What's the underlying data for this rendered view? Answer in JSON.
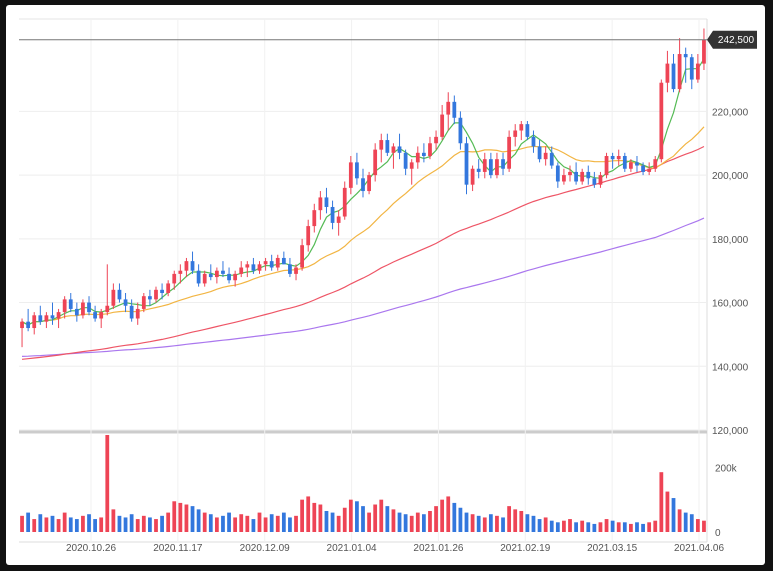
{
  "chart_data": {
    "type": "candlestick",
    "price_axis": {
      "ticks": [
        120000,
        140000,
        160000,
        180000,
        200000,
        220000
      ],
      "tick_labels": [
        "120,000",
        "140,000",
        "160,000",
        "180,000",
        "200,000",
        "220,000"
      ],
      "range": [
        120000,
        249000
      ]
    },
    "volume_axis": {
      "ticks": [
        0,
        200000
      ],
      "tick_labels": [
        "0",
        "200k"
      ],
      "range": [
        0,
        300000
      ]
    },
    "date_axis": {
      "tick_labels": [
        "2020.10.26",
        "2020.11.17",
        "2020.12.09",
        "2021.01.04",
        "2021.01.26",
        "2021.02.19",
        "2021.03.15",
        "2021.04.06"
      ]
    },
    "last_price": 242500,
    "last_price_label": "242,500",
    "colors": {
      "up": "#ee4455",
      "down": "#3377dd",
      "ma5": "#55bb55",
      "ma20": "#f2b543",
      "ma60": "#ee5566",
      "ma120": "#aa77ee"
    },
    "grid": true,
    "candles": [
      [
        152000,
        155000,
        146000,
        154000
      ],
      [
        154000,
        158000,
        151000,
        152000
      ],
      [
        152000,
        157000,
        150000,
        156000
      ],
      [
        156000,
        159000,
        153000,
        154000
      ],
      [
        154000,
        157000,
        152000,
        156000
      ],
      [
        156000,
        160000,
        153000,
        155000
      ],
      [
        155000,
        158000,
        152000,
        157000
      ],
      [
        157000,
        162000,
        155000,
        161000
      ],
      [
        161000,
        163000,
        157000,
        158000
      ],
      [
        158000,
        160000,
        154000,
        156000
      ],
      [
        156000,
        161000,
        155000,
        160000
      ],
      [
        160000,
        162000,
        156000,
        157000
      ],
      [
        157000,
        159000,
        154000,
        155000
      ],
      [
        155000,
        158000,
        152000,
        157000
      ],
      [
        157000,
        172000,
        156000,
        159000
      ],
      [
        159000,
        166000,
        158000,
        164000
      ],
      [
        164000,
        166000,
        160000,
        161000
      ],
      [
        161000,
        163000,
        157000,
        159000
      ],
      [
        159000,
        161000,
        154000,
        155000
      ],
      [
        155000,
        160000,
        153000,
        158000
      ],
      [
        158000,
        163000,
        157000,
        162000
      ],
      [
        162000,
        164000,
        159000,
        161000
      ],
      [
        161000,
        165000,
        160000,
        164000
      ],
      [
        164000,
        166000,
        161000,
        163000
      ],
      [
        163000,
        167000,
        162000,
        166000
      ],
      [
        166000,
        170000,
        164000,
        169000
      ],
      [
        169000,
        172000,
        166000,
        170000
      ],
      [
        170000,
        174000,
        168000,
        173000
      ],
      [
        173000,
        176000,
        169000,
        170000
      ],
      [
        170000,
        172000,
        165000,
        166000
      ],
      [
        166000,
        170000,
        165000,
        169000
      ],
      [
        169000,
        172000,
        167000,
        168000
      ],
      [
        168000,
        171000,
        166000,
        170000
      ],
      [
        170000,
        173000,
        168000,
        169000
      ],
      [
        169000,
        171000,
        166000,
        167000
      ],
      [
        167000,
        170000,
        165000,
        169000
      ],
      [
        169000,
        173000,
        168000,
        171000
      ],
      [
        171000,
        173000,
        168000,
        172000
      ],
      [
        172000,
        174000,
        169000,
        170000
      ],
      [
        170000,
        173000,
        169000,
        172000
      ],
      [
        172000,
        174000,
        170000,
        173000
      ],
      [
        173000,
        175000,
        170000,
        171000
      ],
      [
        171000,
        175000,
        170000,
        174000
      ],
      [
        174000,
        176000,
        172000,
        172000
      ],
      [
        172000,
        174000,
        168000,
        169000
      ],
      [
        169000,
        172000,
        167000,
        171000
      ],
      [
        171000,
        180000,
        170000,
        178000
      ],
      [
        178000,
        186000,
        176000,
        184000
      ],
      [
        184000,
        191000,
        182000,
        189000
      ],
      [
        189000,
        195000,
        186000,
        193000
      ],
      [
        193000,
        196000,
        188000,
        190000
      ],
      [
        190000,
        192000,
        183000,
        185000
      ],
      [
        185000,
        189000,
        181000,
        187000
      ],
      [
        187000,
        198000,
        186000,
        196000
      ],
      [
        196000,
        206000,
        194000,
        204000
      ],
      [
        204000,
        207000,
        197000,
        199000
      ],
      [
        199000,
        202000,
        193000,
        195000
      ],
      [
        195000,
        201000,
        194000,
        200000
      ],
      [
        200000,
        210000,
        198000,
        208000
      ],
      [
        208000,
        213000,
        204000,
        211000
      ],
      [
        211000,
        213000,
        206000,
        207000
      ],
      [
        207000,
        210000,
        202000,
        209000
      ],
      [
        209000,
        213000,
        205000,
        207000
      ],
      [
        207000,
        208000,
        200000,
        202000
      ],
      [
        202000,
        205000,
        197000,
        204000
      ],
      [
        204000,
        209000,
        202000,
        207000
      ],
      [
        207000,
        210000,
        204000,
        206000
      ],
      [
        206000,
        212000,
        205000,
        210000
      ],
      [
        210000,
        214000,
        208000,
        212000
      ],
      [
        212000,
        222000,
        211000,
        219000
      ],
      [
        219000,
        226000,
        214000,
        223000
      ],
      [
        223000,
        225000,
        216000,
        218000
      ],
      [
        218000,
        220000,
        208000,
        210000
      ],
      [
        210000,
        212000,
        194000,
        197000
      ],
      [
        197000,
        203000,
        195000,
        202000
      ],
      [
        202000,
        205000,
        199000,
        201000
      ],
      [
        201000,
        207000,
        199000,
        205000
      ],
      [
        205000,
        207000,
        199000,
        200000
      ],
      [
        200000,
        207000,
        199000,
        205000
      ],
      [
        205000,
        207000,
        200000,
        202000
      ],
      [
        202000,
        214000,
        201000,
        212000
      ],
      [
        212000,
        216000,
        209000,
        214000
      ],
      [
        214000,
        217000,
        211000,
        216000
      ],
      [
        216000,
        217000,
        211000,
        212000
      ],
      [
        212000,
        214000,
        207000,
        209000
      ],
      [
        209000,
        211000,
        204000,
        205000
      ],
      [
        205000,
        209000,
        203000,
        207000
      ],
      [
        207000,
        209000,
        202000,
        203000
      ],
      [
        203000,
        204000,
        196000,
        198000
      ],
      [
        198000,
        202000,
        197000,
        200000
      ],
      [
        200000,
        203000,
        198000,
        201000
      ],
      [
        201000,
        204000,
        197000,
        198000
      ],
      [
        198000,
        202000,
        197000,
        201000
      ],
      [
        201000,
        203000,
        197000,
        199000
      ],
      [
        199000,
        201000,
        196000,
        197000
      ],
      [
        197000,
        201000,
        196000,
        200000
      ],
      [
        200000,
        207000,
        199000,
        206000
      ],
      [
        206000,
        207000,
        202000,
        205000
      ],
      [
        205000,
        208000,
        203000,
        206000
      ],
      [
        206000,
        207000,
        201000,
        202000
      ],
      [
        202000,
        205000,
        201000,
        204000
      ],
      [
        204000,
        206000,
        201000,
        203000
      ],
      [
        203000,
        204000,
        200000,
        201000
      ],
      [
        201000,
        204000,
        200000,
        202000
      ],
      [
        202000,
        206000,
        201000,
        205000
      ],
      [
        205000,
        230000,
        204000,
        229000
      ],
      [
        229000,
        239000,
        226000,
        235000
      ],
      [
        235000,
        238000,
        226000,
        227000
      ],
      [
        227000,
        243000,
        226000,
        238000
      ],
      [
        238000,
        240000,
        229000,
        237000
      ],
      [
        237000,
        238000,
        227000,
        230000
      ],
      [
        230000,
        238000,
        229000,
        235000
      ],
      [
        235000,
        246000,
        233000,
        242500
      ]
    ],
    "volume": [
      50000,
      60000,
      40000,
      55000,
      45000,
      50000,
      40000,
      60000,
      45000,
      40000,
      50000,
      55000,
      40000,
      45000,
      300000,
      70000,
      50000,
      45000,
      55000,
      40000,
      50000,
      45000,
      40000,
      50000,
      60000,
      95000,
      90000,
      85000,
      80000,
      70000,
      60000,
      55000,
      45000,
      50000,
      60000,
      45000,
      55000,
      50000,
      40000,
      60000,
      45000,
      55000,
      50000,
      60000,
      45000,
      50000,
      100000,
      110000,
      90000,
      85000,
      65000,
      60000,
      50000,
      75000,
      100000,
      95000,
      80000,
      60000,
      85000,
      100000,
      80000,
      70000,
      60000,
      55000,
      50000,
      60000,
      55000,
      65000,
      80000,
      100000,
      110000,
      90000,
      75000,
      60000,
      55000,
      50000,
      45000,
      55000,
      50000,
      45000,
      80000,
      70000,
      65000,
      55000,
      50000,
      40000,
      45000,
      35000,
      30000,
      35000,
      40000,
      30000,
      35000,
      30000,
      25000,
      30000,
      40000,
      35000,
      30000,
      30000,
      25000,
      30000,
      25000,
      30000,
      35000,
      185000,
      125000,
      105000,
      70000,
      60000,
      55000,
      40000,
      35000
    ]
  }
}
